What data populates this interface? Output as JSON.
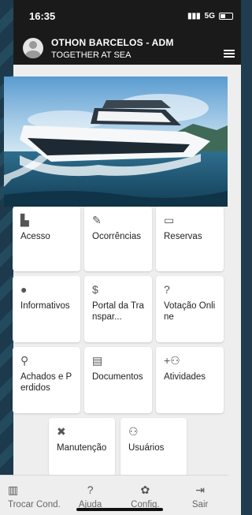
{
  "status": {
    "time": "16:35",
    "network": "5G"
  },
  "header": {
    "title": "OTHON BARCELOS - ADM",
    "subtitle": "TOGETHER AT SEA"
  },
  "menu": [
    {
      "id": "acesso",
      "label": "Acesso",
      "icon": "door-icon"
    },
    {
      "id": "ocorrencias",
      "label": "Ocorrências",
      "icon": "pen-check-icon"
    },
    {
      "id": "reservas",
      "label": "Reservas",
      "icon": "calendar-icon"
    },
    {
      "id": "informativos",
      "label": "Informativos",
      "icon": "info-icon"
    },
    {
      "id": "portal",
      "label": "Portal da Transpar...",
      "icon": "dollar-icon"
    },
    {
      "id": "votacao",
      "label": "Votação Online",
      "icon": "question-icon"
    },
    {
      "id": "achados",
      "label": "Achados e Perdidos",
      "icon": "search-icon"
    },
    {
      "id": "documentos",
      "label": "Documentos",
      "icon": "document-icon"
    },
    {
      "id": "atividades",
      "label": "Atividades",
      "icon": "add-users-icon"
    },
    {
      "id": "manutencao",
      "label": "Manutenção",
      "icon": "tools-icon"
    },
    {
      "id": "usuarios",
      "label": "Usuários",
      "icon": "user-gear-icon"
    }
  ],
  "bottom_nav": [
    {
      "label": "Trocar Cond.",
      "icon": "building-icon"
    },
    {
      "label": "Ajuda",
      "icon": "help-icon"
    },
    {
      "label": "Config.",
      "icon": "gear-icon"
    },
    {
      "label": "Sair",
      "icon": "logout-icon"
    }
  ]
}
